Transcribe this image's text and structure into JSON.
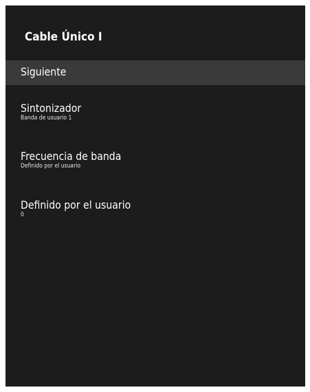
{
  "panel": {
    "title": "Cable Único I",
    "items": [
      {
        "label": "Siguiente"
      },
      {
        "label": "Sintonizador",
        "value": "Banda de usuario 1"
      },
      {
        "label": "Frecuencia de banda",
        "value": "Definido por el usuario"
      },
      {
        "label": "Definido por el usuario",
        "value": "0"
      }
    ]
  },
  "colors": {
    "panel_background": "#1c1c1c",
    "selected_row": "#3a3a3a",
    "text": "#ffffff"
  }
}
